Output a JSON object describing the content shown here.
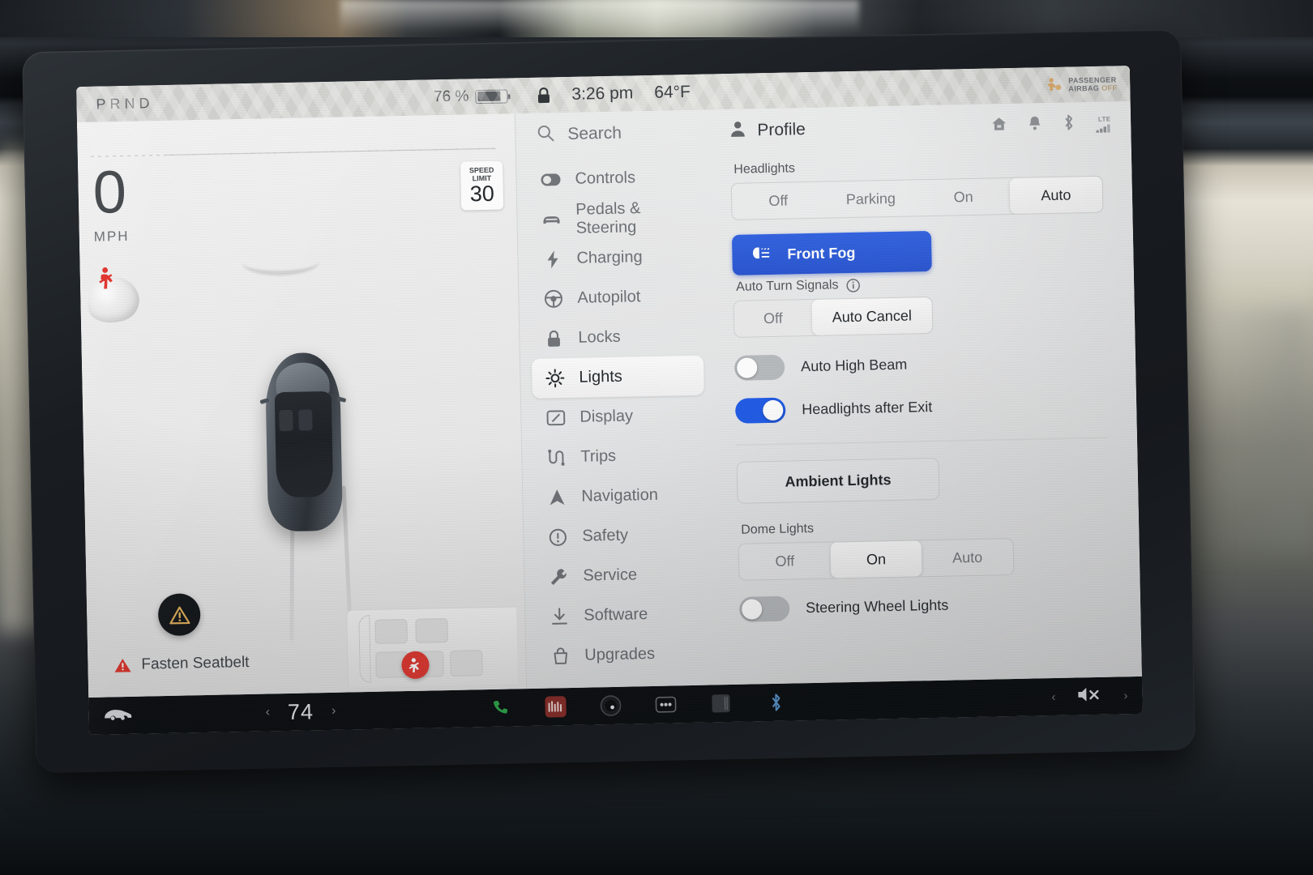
{
  "status_bar": {
    "prnd": "PRND",
    "battery_percent": "76 %",
    "lock_icon": "lock-icon",
    "time": "3:26 pm",
    "exterior_temp": "64°F",
    "airbag_line1": "PASSENGER",
    "airbag_line2": "AIRBAG",
    "airbag_state": "OFF"
  },
  "drive_view": {
    "speed": "0",
    "speed_unit": "MPH",
    "speed_limit_label_1": "SPEED",
    "speed_limit_label_2": "LIMIT",
    "speed_limit_value": "30",
    "warning_text": "Fasten Seatbelt",
    "warning_badge_icon": "warning-triangle-icon",
    "seatbelt_icon": "seatbelt-warning-icon"
  },
  "controls_header": {
    "search_label": "Search",
    "search_icon": "search-icon",
    "profile_label": "Profile",
    "profile_icon": "person-icon",
    "status_icons": [
      "home-icon",
      "notification-bell-icon",
      "bluetooth-icon",
      "lte-signal-icon"
    ],
    "lte_label": "LTE"
  },
  "menu": {
    "items": [
      {
        "label": "Controls",
        "icon": "toggle-switch-icon",
        "active": false
      },
      {
        "label": "Pedals & Steering",
        "icon": "car-front-icon",
        "active": false
      },
      {
        "label": "Charging",
        "icon": "lightning-bolt-icon",
        "active": false
      },
      {
        "label": "Autopilot",
        "icon": "steering-wheel-icon",
        "active": false
      },
      {
        "label": "Locks",
        "icon": "padlock-icon",
        "active": false
      },
      {
        "label": "Lights",
        "icon": "sun-brightness-icon",
        "active": true
      },
      {
        "label": "Display",
        "icon": "screen-icon",
        "active": false
      },
      {
        "label": "Trips",
        "icon": "trip-route-icon",
        "active": false
      },
      {
        "label": "Navigation",
        "icon": "navigation-arrow-icon",
        "active": false
      },
      {
        "label": "Safety",
        "icon": "exclamation-circle-icon",
        "active": false
      },
      {
        "label": "Service",
        "icon": "wrench-icon",
        "active": false
      },
      {
        "label": "Software",
        "icon": "download-arrow-icon",
        "active": false
      },
      {
        "label": "Upgrades",
        "icon": "shopping-bag-icon",
        "active": false
      }
    ]
  },
  "lights_pane": {
    "headlights": {
      "title": "Headlights",
      "options": [
        "Off",
        "Parking",
        "On",
        "Auto"
      ],
      "selected": "Auto"
    },
    "front_fog": {
      "label": "Front Fog",
      "icon": "fog-light-icon",
      "active": true,
      "accent_color": "#2551cf"
    },
    "auto_turn_signals": {
      "title": "Auto Turn Signals",
      "info_icon": "info-circle-icon",
      "options": [
        "Off",
        "Auto Cancel"
      ],
      "selected": "Auto Cancel"
    },
    "auto_high_beam": {
      "label": "Auto High Beam",
      "state": "off"
    },
    "headlights_after_exit": {
      "label": "Headlights after Exit",
      "state": "on"
    },
    "ambient_lights": {
      "label": "Ambient Lights"
    },
    "dome_lights": {
      "title": "Dome Lights",
      "options": [
        "Off",
        "On",
        "Auto"
      ],
      "selected": "On"
    },
    "steering_wheel_lights": {
      "label": "Steering Wheel Lights",
      "state": "off"
    }
  },
  "app_bar": {
    "car_icon": "car-side-icon",
    "temp_value": "74",
    "chevron_left": "‹",
    "chevron_right": "›",
    "icons": [
      "phone-icon",
      "media-player-icon",
      "camera-icon",
      "more-dots-icon",
      "card-icon",
      "bluetooth-icon"
    ],
    "volume_icon": "volume-muted-icon"
  }
}
